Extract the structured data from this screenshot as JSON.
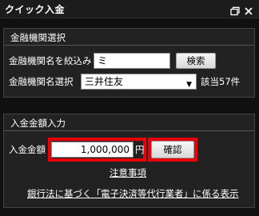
{
  "window": {
    "title": "クイック入金"
  },
  "bank_selection": {
    "heading": "金融機関選択",
    "filter_label": "金融機関名を絞込み",
    "filter_value": "ミ",
    "search_button": "検索",
    "bank_label": "金融機関名選択",
    "selected_bank": "三井住友",
    "match_count": "該当57件"
  },
  "deposit": {
    "heading": "入金金額入力",
    "amount_label": "入金金額",
    "amount_value": "1,000,000",
    "unit": "円",
    "confirm_button": "確認",
    "notes_link": "注意事項",
    "legal_link": "銀行法に基づく「電子決済等代行業者」に係る表示"
  },
  "colors": {
    "highlight": "#e8000b",
    "background": "#111111"
  }
}
